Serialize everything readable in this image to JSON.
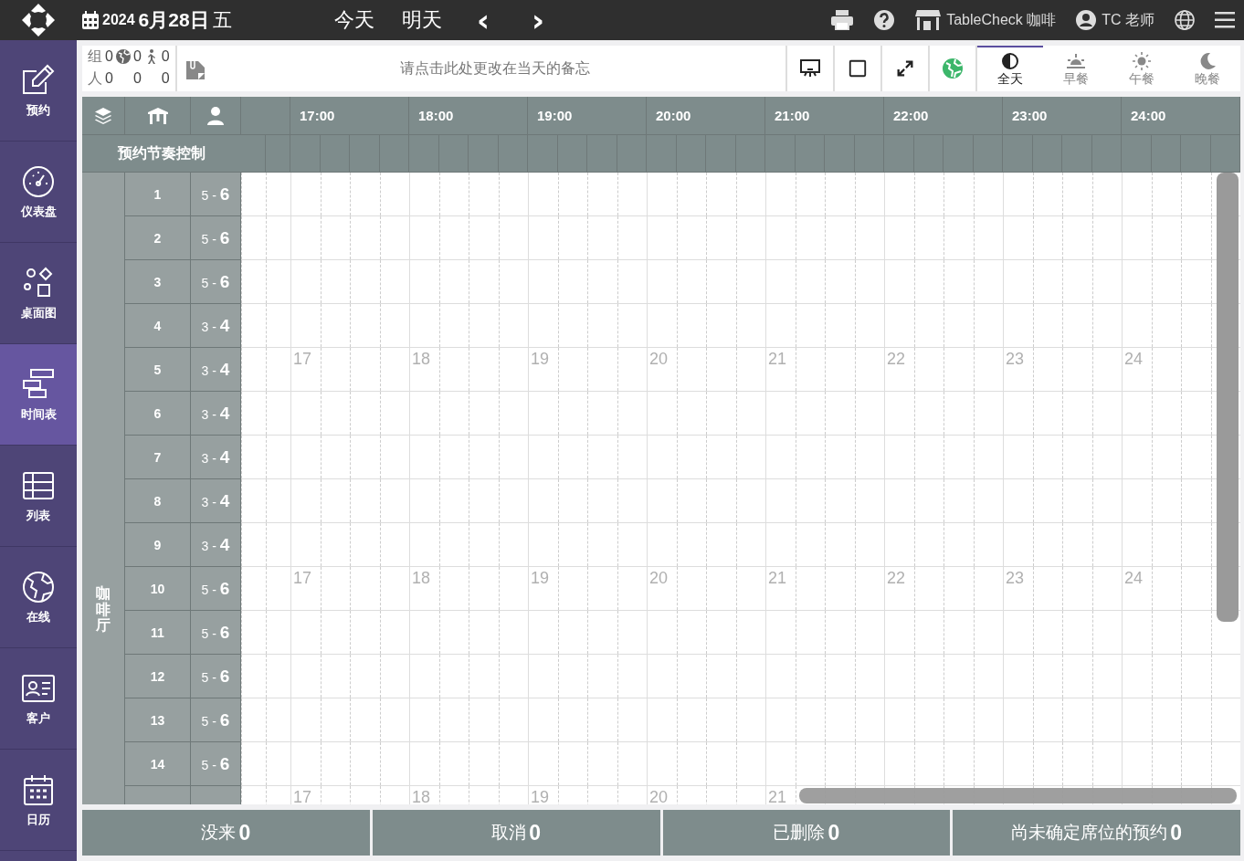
{
  "topbar": {
    "year": "2024",
    "date": "6月28日",
    "weekday": "五",
    "today": "今天",
    "tomorrow": "明天",
    "prev": "‹",
    "next": "›",
    "store": "TableCheck 咖啡",
    "user": "TC 老师"
  },
  "sidebar": {
    "items": [
      {
        "label": "预约",
        "selected": false
      },
      {
        "label": "仪表盘",
        "selected": false
      },
      {
        "label": "桌面图",
        "selected": false
      },
      {
        "label": "时间表",
        "selected": true
      },
      {
        "label": "列表",
        "selected": false
      },
      {
        "label": "在线",
        "selected": false
      },
      {
        "label": "客户",
        "selected": false
      },
      {
        "label": "日历",
        "selected": false
      }
    ]
  },
  "stats": {
    "groups_label": "组",
    "groups": "0",
    "online_groups": "0",
    "walkin_groups": "0",
    "people_label": "人",
    "people": "0",
    "online_people": "0",
    "walkin_people": "0"
  },
  "memo": {
    "placeholder": "请点击此处更改在当天的备忘"
  },
  "meal_tabs": [
    {
      "label": "全天",
      "selected": true
    },
    {
      "label": "早餐",
      "selected": false
    },
    {
      "label": "午餐",
      "selected": false
    },
    {
      "label": "晚餐",
      "selected": false
    }
  ],
  "timeline": {
    "hours": [
      "17:00",
      "18:00",
      "19:00",
      "20:00",
      "21:00",
      "22:00",
      "23:00",
      "24:00"
    ],
    "pacing_label": "预约节奏控制",
    "area": "咖啡厅",
    "rows": [
      {
        "table": "1",
        "capacity": "5 - **6**"
      },
      {
        "table": "2",
        "capacity": "5 - **6**"
      },
      {
        "table": "3",
        "capacity": "5 - **6**"
      },
      {
        "table": "4",
        "capacity": "3 - **4**"
      },
      {
        "table": "5",
        "capacity": "3 - **4**",
        "hour_labels": [
          "17",
          "18",
          "19",
          "20",
          "21",
          "22",
          "23",
          "24"
        ]
      },
      {
        "table": "6",
        "capacity": "3 - **4**"
      },
      {
        "table": "7",
        "capacity": "3 - **4**"
      },
      {
        "table": "8",
        "capacity": "3 - **4**"
      },
      {
        "table": "9",
        "capacity": "3 - **4**"
      },
      {
        "table": "10",
        "capacity": "5 - **6**",
        "hour_labels": [
          "17",
          "18",
          "19",
          "20",
          "21",
          "22",
          "23",
          "24"
        ]
      },
      {
        "table": "11",
        "capacity": "5 - **6**"
      },
      {
        "table": "12",
        "capacity": "5 - **6**"
      },
      {
        "table": "13",
        "capacity": "5 - **6**"
      },
      {
        "table": "14",
        "capacity": "5 - **6**"
      },
      {
        "hour_labels": [
          "17",
          "18",
          "19",
          "20",
          "21"
        ]
      }
    ]
  },
  "footer": [
    {
      "label": "没来",
      "count": "0"
    },
    {
      "label": "取消",
      "count": "0"
    },
    {
      "label": "已删除",
      "count": "0"
    },
    {
      "label": "尚未确定席位的预约",
      "count": "0"
    }
  ]
}
